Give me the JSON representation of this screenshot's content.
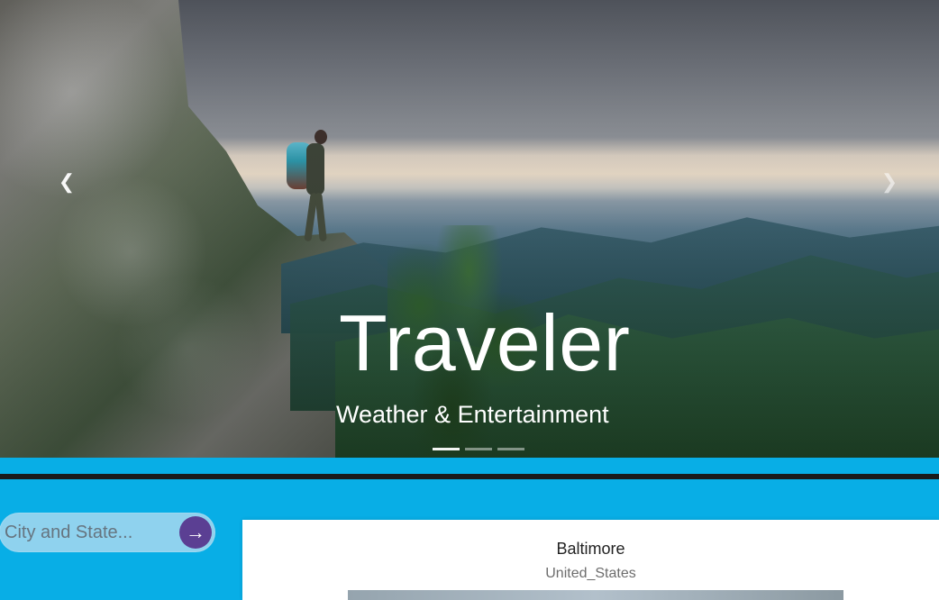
{
  "hero": {
    "title": "Traveler",
    "subtitle": "Weather & Entertainment",
    "left_arrow_icon": "chevron-left-icon",
    "right_arrow_icon": "chevron-right-icon",
    "indicators": [
      {
        "state": "active"
      },
      {
        "state": "inactive"
      },
      {
        "state": "inactive"
      }
    ]
  },
  "search": {
    "placeholder": "City and State...",
    "button_icon": "arrow-right-icon"
  },
  "result": {
    "city": "Baltimore",
    "country": "United_States"
  }
}
